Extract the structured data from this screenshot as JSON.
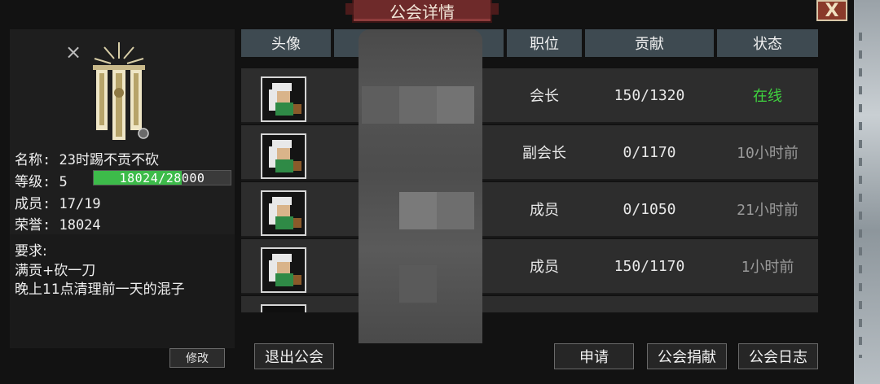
{
  "window": {
    "title": "公会详情",
    "close_label": "X"
  },
  "guild": {
    "name_line": "名称: 23时踢不贡不砍",
    "level_label": "等级: 5",
    "level_progress": "18024/28000",
    "level_fraction": 0.644,
    "members_line": "成员: 17/19",
    "honor_line": "荣誉: 18024",
    "requirements": [
      "要求:",
      "满贡+砍一刀",
      "晚上11点清理前一天的混子"
    ],
    "edit_label": "修改"
  },
  "table": {
    "headers": {
      "avatar": "头像",
      "position": "职位",
      "contribution": "贡献",
      "status": "状态"
    },
    "rows": [
      {
        "position": "会长",
        "contribution": "150/1320",
        "status": "在线",
        "status_color": "#3fd23f"
      },
      {
        "position": "副会长",
        "contribution": "0/1170",
        "status": "10小时前",
        "status_color": "#9a9a9a"
      },
      {
        "position": "成员",
        "contribution": "0/1050",
        "status": "21小时前",
        "status_color": "#9a9a9a"
      },
      {
        "position": "成员",
        "contribution": "150/1170",
        "status": "1小时前",
        "status_color": "#9a9a9a"
      }
    ]
  },
  "buttons": {
    "leave": "退出公会",
    "apply": "申请",
    "donate": "公会捐献",
    "log": "公会日志"
  },
  "colors": {
    "online": "#3fd23f",
    "offline": "#9a9a9a",
    "level_bar": "#3dbb4a",
    "header_bg": "#3e4a51"
  }
}
